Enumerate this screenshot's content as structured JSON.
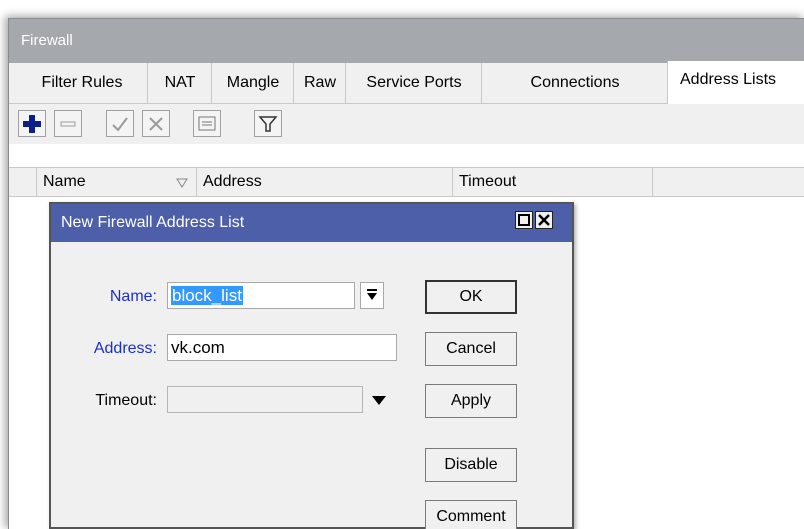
{
  "window": {
    "title": "Firewall"
  },
  "tabs": [
    {
      "label": "Filter Rules"
    },
    {
      "label": "NAT"
    },
    {
      "label": "Mangle"
    },
    {
      "label": "Raw"
    },
    {
      "label": "Service Ports"
    },
    {
      "label": "Connections"
    },
    {
      "label": "Address Lists"
    }
  ],
  "active_tab": "Address Lists",
  "toolbar": {
    "buttons": [
      "plus-icon",
      "minus-icon",
      "check-icon",
      "cross-icon",
      "comment-icon",
      "filter-icon"
    ]
  },
  "table": {
    "columns": [
      "Name",
      "Address",
      "Timeout"
    ]
  },
  "dialog": {
    "title": "New Firewall Address List",
    "name_label": "Name:",
    "name_value": "block_list",
    "address_label": "Address:",
    "address_value": "vk.com",
    "timeout_label": "Timeout:",
    "timeout_value": "",
    "buttons": {
      "ok": "OK",
      "cancel": "Cancel",
      "apply": "Apply",
      "disable": "Disable",
      "comment": "Comment"
    }
  },
  "colors": {
    "dialog_title_bg": "#4d5fa8",
    "window_title_bg": "#a5a8ad",
    "label_blue": "#1a2fd0",
    "selection": "#3399ff"
  }
}
